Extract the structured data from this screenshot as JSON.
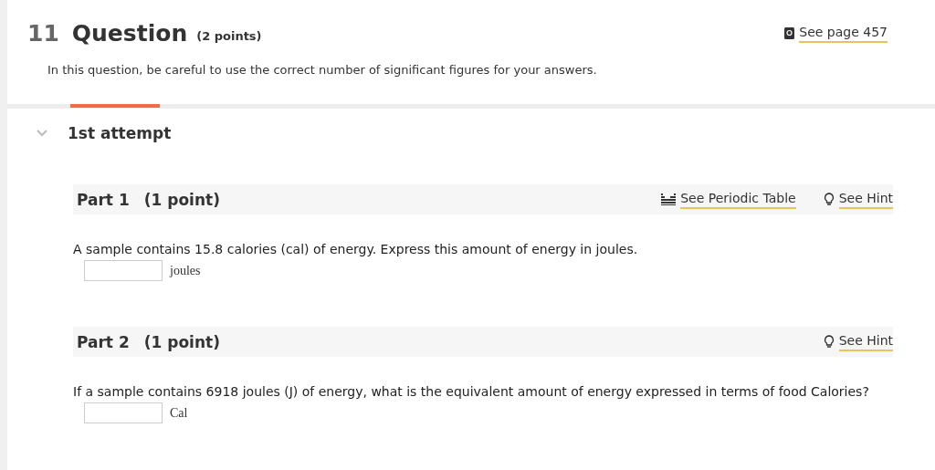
{
  "question": {
    "number": "11",
    "title": "Question",
    "points": "(2 points)",
    "reference": "See page 457",
    "instructions": "In this question, be careful to use the correct number of significant figures for your answers."
  },
  "attempt": {
    "label": "1st attempt",
    "expanded": true
  },
  "parts": [
    {
      "title": "Part 1",
      "points": "(1 point)",
      "links": [
        {
          "kind": "periodic",
          "label": "See Periodic Table"
        },
        {
          "kind": "hint",
          "label": "See Hint"
        }
      ],
      "prompt": "A sample contains 15.8 calories (cal) of energy. Express this amount of energy in joules.",
      "unit": "joules"
    },
    {
      "title": "Part 2",
      "points": "(1 point)",
      "links": [
        {
          "kind": "hint",
          "label": "See Hint"
        }
      ],
      "prompt": "If a sample contains 6918 joules (J) of energy, what is the equivalent amount of energy expressed in terms of food Calories?",
      "unit": "Cal"
    }
  ]
}
